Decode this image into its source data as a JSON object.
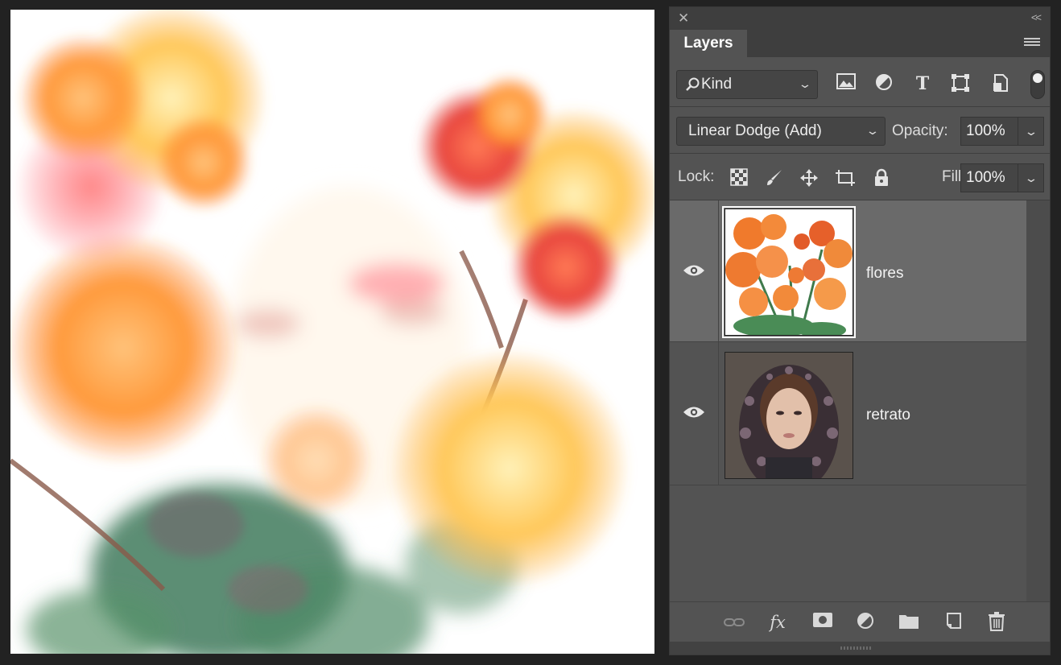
{
  "panel": {
    "tab_label": "Layers",
    "close_glyph": "✕",
    "collapse_glyph": "<<"
  },
  "filter": {
    "kind_label": "Kind",
    "icons": [
      "image-filter-icon",
      "adjustment-filter-icon",
      "type-filter-icon",
      "shape-filter-icon",
      "smart-object-filter-icon"
    ]
  },
  "blend": {
    "mode": "Linear Dodge (Add)",
    "opacity_label": "Opacity:",
    "opacity_value": "100%"
  },
  "lock": {
    "label": "Lock:",
    "fill_label": "Fill:",
    "fill_value": "100%"
  },
  "layers": [
    {
      "name": "flores",
      "visible": true,
      "selected": true
    },
    {
      "name": "retrato",
      "visible": true,
      "selected": false
    }
  ],
  "bottom_icons": [
    "link-layers-icon",
    "fx-icon",
    "add-mask-icon",
    "new-adjustment-icon",
    "new-group-icon",
    "new-layer-icon",
    "delete-icon"
  ]
}
